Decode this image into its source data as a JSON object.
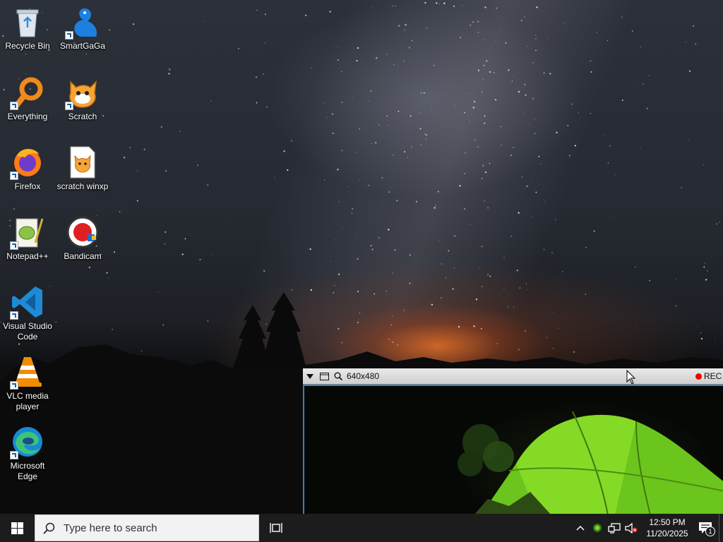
{
  "desktop": {
    "icons": [
      {
        "label": "Recycle Bin",
        "icon": "recycle-bin-icon"
      },
      {
        "label": "SmartGaGa",
        "icon": "smartgaga-icon"
      },
      {
        "label": "Everything",
        "icon": "everything-search-icon"
      },
      {
        "label": "Scratch",
        "icon": "scratch-cat-icon"
      },
      {
        "label": "Firefox",
        "icon": "firefox-icon"
      },
      {
        "label": "scratch winxp",
        "icon": "scratch-file-icon"
      },
      {
        "label": "Notepad++",
        "icon": "notepad-plus-plus-icon"
      },
      {
        "label": "Bandicam",
        "icon": "bandicam-icon"
      },
      {
        "label": "Visual Studio Code",
        "icon": "vscode-icon"
      },
      {
        "label": "VLC media player",
        "icon": "vlc-icon"
      },
      {
        "label": "Microsoft Edge",
        "icon": "edge-icon"
      }
    ]
  },
  "bandicam": {
    "size_label": "640x480",
    "rec_label": "REC",
    "accent": "#3a7fb8"
  },
  "taskbar": {
    "search_placeholder": "Type here to search",
    "time": "12:50 PM",
    "date": "11/20/2025",
    "notification_count": "1",
    "background": "#1c1c1c"
  }
}
